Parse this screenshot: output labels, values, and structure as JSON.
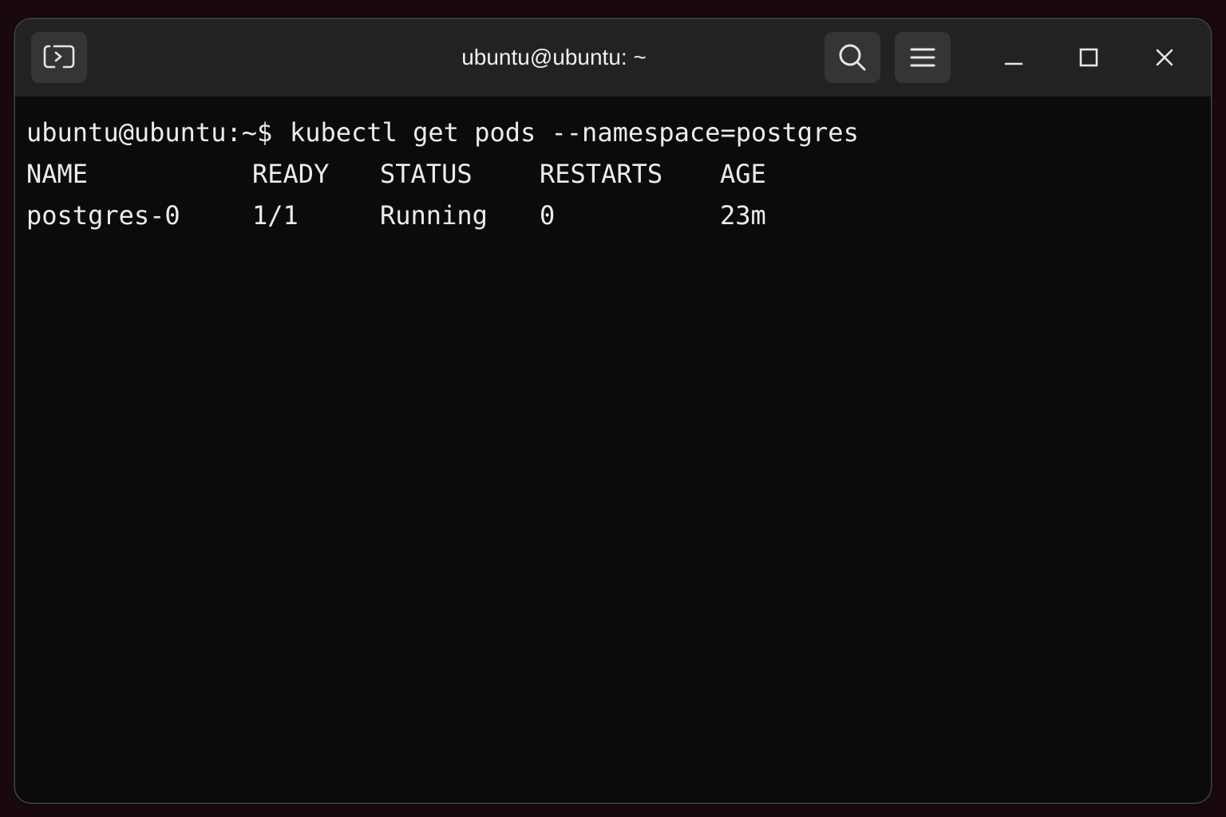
{
  "window": {
    "title": "ubuntu@ubuntu: ~"
  },
  "titlebar": {
    "icons": {
      "new_tab": "terminal-new-tab-icon",
      "search": "search-icon",
      "menu": "hamburger-menu-icon",
      "minimize": "minimize-icon",
      "maximize": "maximize-icon",
      "close": "close-icon"
    }
  },
  "terminal": {
    "prompt": "ubuntu@ubuntu:~$",
    "command": "kubectl get pods --namespace=postgres",
    "columns": [
      "NAME",
      "READY",
      "STATUS",
      "RESTARTS",
      "AGE"
    ],
    "rows": [
      [
        "postgres-0",
        "1/1",
        "Running",
        "0",
        "23m"
      ]
    ]
  },
  "colors": {
    "background": "#1a0810",
    "titlebar": "#222222",
    "terminal_bg": "#0b0b0b",
    "text": "#ececec"
  }
}
